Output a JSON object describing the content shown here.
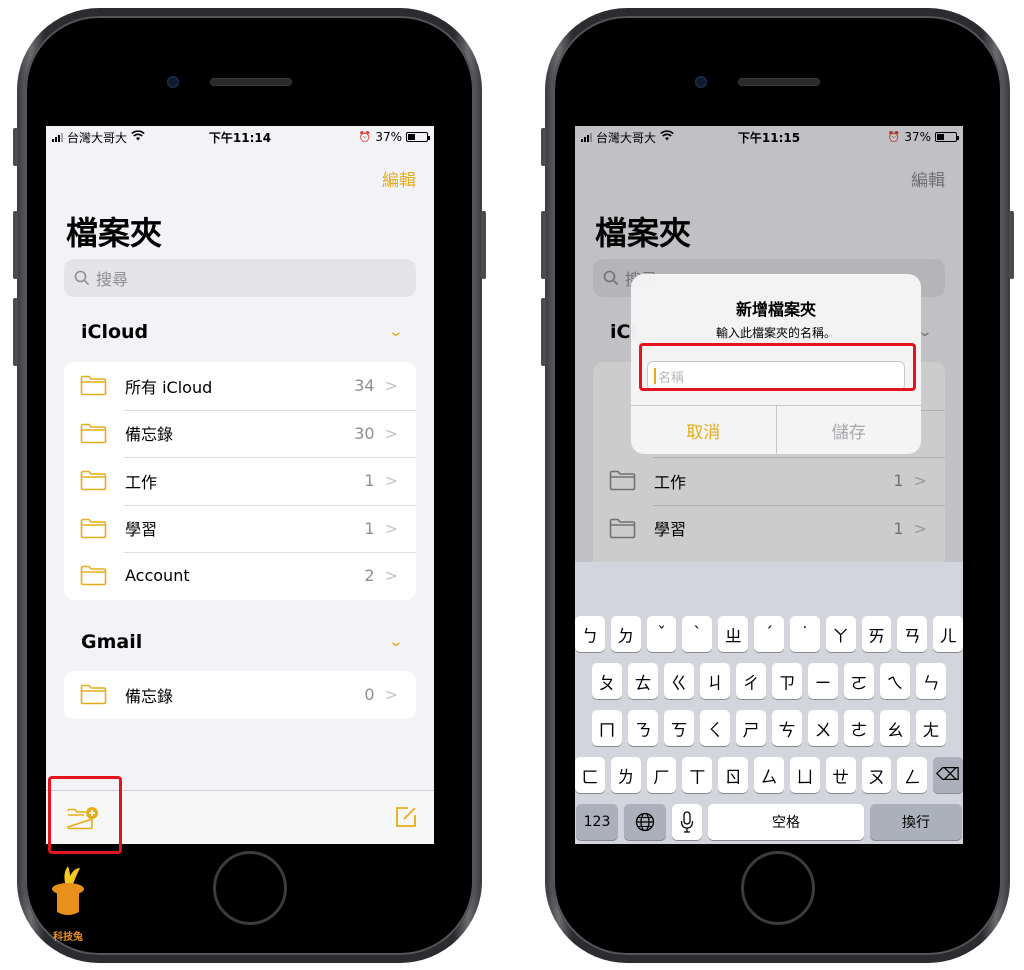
{
  "colors": {
    "accent": "#e6ad1a",
    "highlight": "#e3141b",
    "text_secondary": "#8e8e93"
  },
  "left_phone": {
    "status": {
      "carrier": "台灣大哥大",
      "time": "下午11:14",
      "battery": "37%",
      "battery_level": 0.37
    },
    "edit_label": "編輯",
    "title": "檔案夾",
    "search_placeholder": "搜尋",
    "sections": [
      {
        "name": "iCloud",
        "folders": [
          {
            "name": "所有 iCloud",
            "count": "34"
          },
          {
            "name": "備忘錄",
            "count": "30"
          },
          {
            "name": "工作",
            "count": "1"
          },
          {
            "name": "學習",
            "count": "1"
          },
          {
            "name": "Account",
            "count": "2"
          }
        ]
      },
      {
        "name": "Gmail",
        "folders": [
          {
            "name": "備忘錄",
            "count": "0"
          }
        ]
      }
    ],
    "toolbar": {
      "new_folder_icon": "folder-plus-icon",
      "compose_icon": "compose-icon"
    }
  },
  "right_phone": {
    "status": {
      "carrier": "台灣大哥大",
      "time": "下午11:15",
      "battery": "37%",
      "battery_level": 0.37
    },
    "edit_label": "編輯",
    "title": "檔案夾",
    "search_placeholder": "搜尋",
    "section_partial": "iCl",
    "folders_visible": [
      {
        "name": "工作",
        "count": "1"
      },
      {
        "name": "學習",
        "count": "1"
      }
    ],
    "alert": {
      "title": "新增檔案夾",
      "message": "輸入此檔案夾的名稱。",
      "input_placeholder": "名稱",
      "input_value": "",
      "cancel_label": "取消",
      "save_label": "儲存"
    },
    "keyboard": {
      "rows": [
        [
          "ㄅ",
          "ㄉ",
          "ˇ",
          "ˋ",
          "ㄓ",
          "ˊ",
          "˙",
          "ㄚ",
          "ㄞ",
          "ㄢ",
          "ㄦ"
        ],
        [
          "ㄆ",
          "ㄊ",
          "ㄍ",
          "ㄐ",
          "ㄔ",
          "ㄗ",
          "ㄧ",
          "ㄛ",
          "ㄟ",
          "ㄣ"
        ],
        [
          "ㄇ",
          "ㄋ",
          "ㄎ",
          "ㄑ",
          "ㄕ",
          "ㄘ",
          "ㄨ",
          "ㄜ",
          "ㄠ",
          "ㄤ"
        ],
        [
          "ㄈ",
          "ㄌ",
          "ㄏ",
          "ㄒ",
          "ㄖ",
          "ㄙ",
          "ㄩ",
          "ㄝ",
          "ㄡ",
          "ㄥ"
        ]
      ],
      "backspace_icon": "⌫",
      "numbers_label": "123",
      "globe_icon": "globe-icon",
      "mic_icon": "mic-icon",
      "space_label": "空格",
      "return_label": "換行"
    }
  },
  "watermark": {
    "text": "科技兔"
  }
}
